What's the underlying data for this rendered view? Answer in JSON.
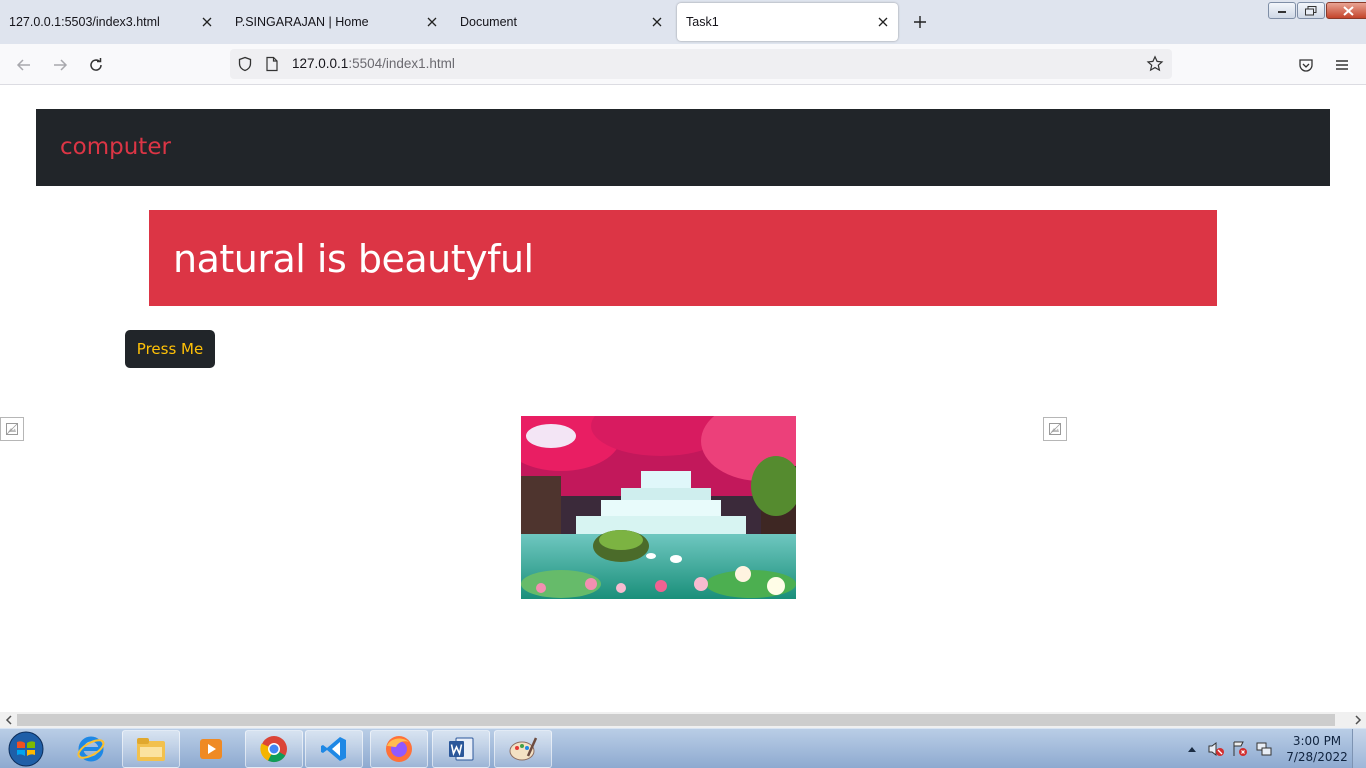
{
  "browser": {
    "tabs": [
      {
        "title": "127.0.0.1:5503/index3.html",
        "active": false
      },
      {
        "title": "P.SINGARAJAN | Home",
        "active": false
      },
      {
        "title": "Document",
        "active": false
      },
      {
        "title": "Task1",
        "active": true
      }
    ],
    "url_host": "127.0.0.1",
    "url_rest": ":5504/index1.html"
  },
  "page": {
    "brand": "computer",
    "hero": "natural is beautyful",
    "button_label": "Press Me"
  },
  "colors": {
    "dark": "#212529",
    "danger": "#dc3545",
    "warning": "#ffc107"
  },
  "taskbar": {
    "apps": [
      "internet-explorer-icon",
      "file-explorer-icon",
      "media-player-icon",
      "chrome-icon",
      "vscode-icon",
      "firefox-icon",
      "word-icon",
      "paint-icon"
    ],
    "time": "3:00 PM",
    "date": "7/28/2022"
  }
}
